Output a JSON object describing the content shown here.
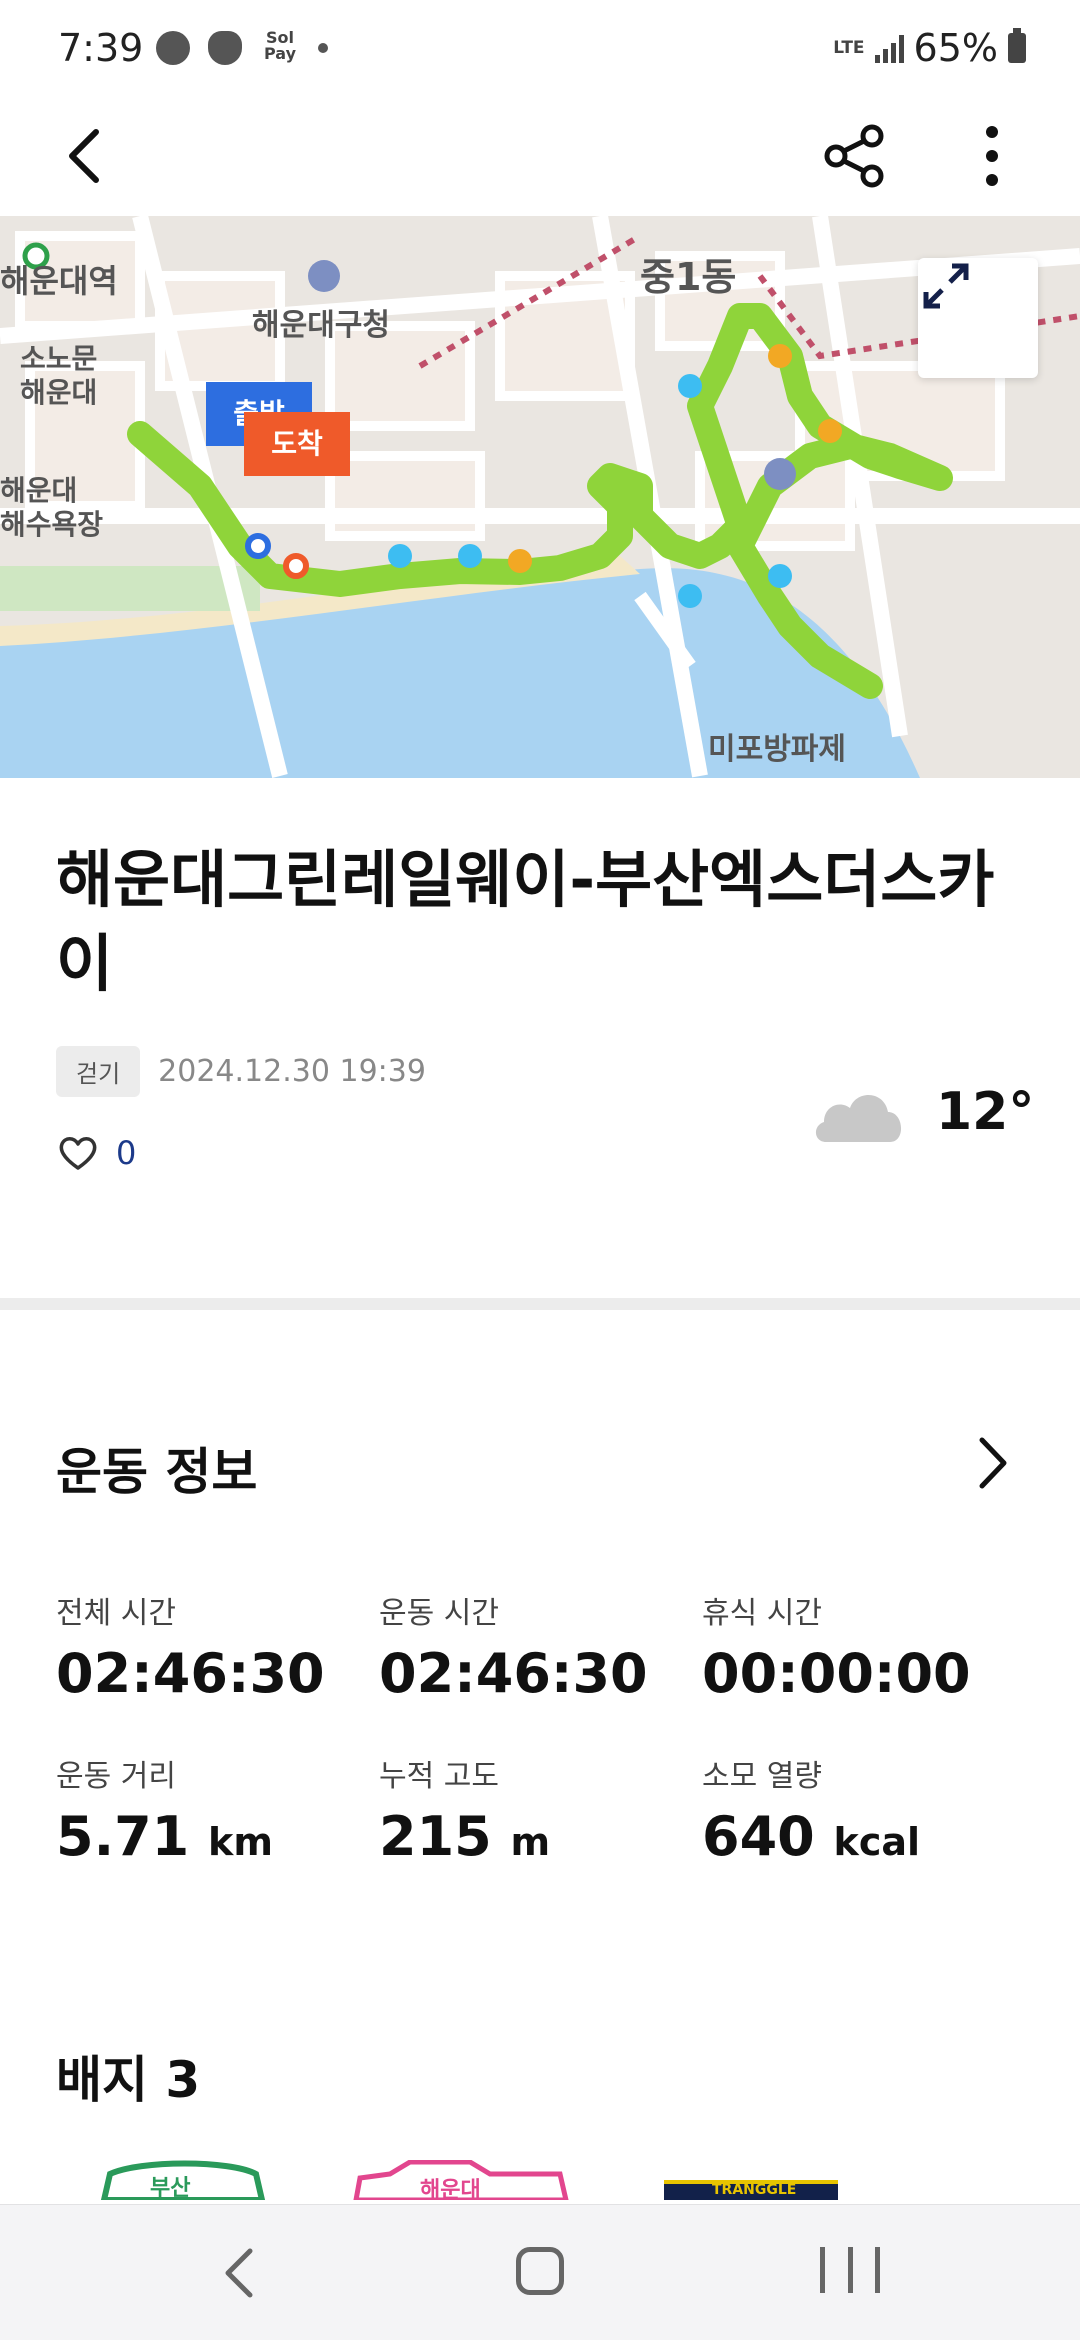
{
  "status": {
    "time": "7:39",
    "pay_label": "Sol Pay",
    "network": "LTE",
    "battery": "65%"
  },
  "app_bar": {
    "back_icon": "chevron-left-icon",
    "share_icon": "share-icon",
    "more_icon": "more-vertical-icon"
  },
  "map": {
    "labels": {
      "station": "해운대역",
      "gu_office": "해운대구청",
      "dong": "중1동",
      "sonomun": "소노문\n해운대",
      "beach": "해운대\n해수욕장",
      "mipo": "미포방파제"
    },
    "start_marker": "출발",
    "end_marker": "도착",
    "expand_icon": "expand-icon",
    "route_color": "#8fd43a"
  },
  "activity": {
    "title": "해운대그린레일웨이-부산엑스더스카이",
    "type_tag": "걷기",
    "datetime": "2024.12.30 19:39",
    "likes": "0",
    "temperature": "12°",
    "weather_icon": "cloud-icon"
  },
  "exercise_info": {
    "title": "운동 정보",
    "stats": [
      {
        "label": "전체 시간",
        "value": "02:46:30",
        "unit": ""
      },
      {
        "label": "운동 시간",
        "value": "02:46:30",
        "unit": ""
      },
      {
        "label": "휴식 시간",
        "value": "00:00:00",
        "unit": ""
      },
      {
        "label": "운동 거리",
        "value": "5.71",
        "unit": "km"
      },
      {
        "label": "누적 고도",
        "value": "215",
        "unit": "m"
      },
      {
        "label": "소모 열량",
        "value": "640",
        "unit": "kcal"
      }
    ]
  },
  "badges": {
    "title": "배지 3",
    "items": [
      "부산",
      "해운대",
      "TRANGGLE"
    ]
  },
  "nav": {
    "back_icon": "nav-back-icon",
    "home_icon": "nav-home-icon",
    "recent_icon": "nav-recent-icon"
  }
}
